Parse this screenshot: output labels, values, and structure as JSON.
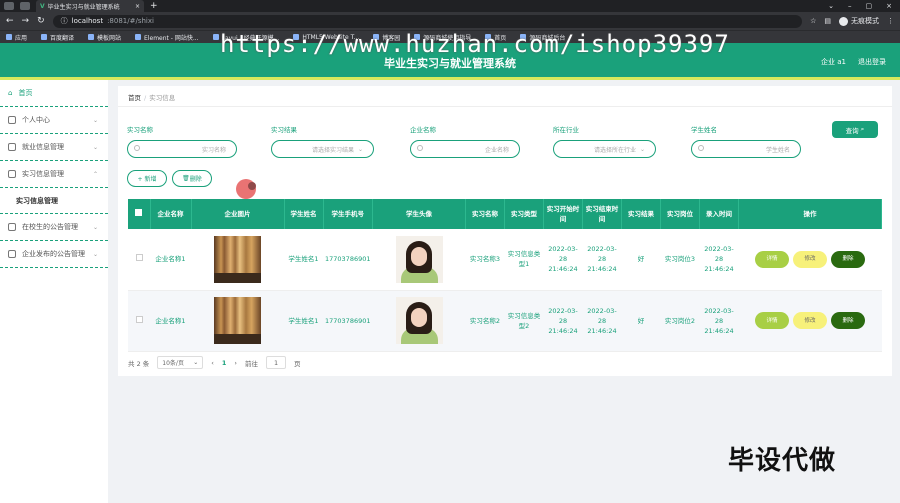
{
  "browser": {
    "tab_title": "毕业生实习与就业管理系统",
    "url_host": "localhost",
    "url_rest": ":8081/#/shixi",
    "incognito": "无痕模式",
    "bookmarks": [
      "应用",
      "百度翻译",
      "模板网站",
      "Element - 网站快...",
      "Layui - 经典开源模...",
      "HTML5 Website T...",
      "博客园",
      "源码商城使用指导",
      "首页",
      "源码商城后台"
    ]
  },
  "watermark": "https://www.huzhan.com/ishop39397",
  "header": {
    "title": "毕业生实习与就业管理系统",
    "user": "企业 a1",
    "logout": "退出登录"
  },
  "sidebar": {
    "home": "首页",
    "items": [
      "个人中心",
      "就业信息管理",
      "实习信息管理"
    ],
    "submenu": "实习信息管理",
    "items2": [
      "在校生的公告管理",
      "企业发布的公告管理"
    ]
  },
  "breadcrumb": {
    "home": "首页",
    "current": "实习信息"
  },
  "filters": [
    {
      "label": "实习名称",
      "placeholder": "实习名称"
    },
    {
      "label": "实习结果",
      "placeholder": "请选择实习结果"
    },
    {
      "label": "企业名称",
      "placeholder": "企业名称"
    },
    {
      "label": "所在行业",
      "placeholder": "请选择所在行业"
    },
    {
      "label": "学生姓名",
      "placeholder": "学生姓名"
    }
  ],
  "buttons": {
    "search": "查询",
    "add": "+ 新增",
    "delete": "删除"
  },
  "table": {
    "headers": [
      "企业名称",
      "企业图片",
      "学生姓名",
      "学生手机号",
      "学生头像",
      "实习名称",
      "实习类型",
      "实习开始时间",
      "实习结束时间",
      "实习结果",
      "实习岗位",
      "录入时间",
      "操作"
    ],
    "rows": [
      {
        "company": "企业名称1",
        "student": "学生姓名1",
        "phone": "17703786901",
        "intern_name": "实习名称3",
        "intern_type": "实习信息类型1",
        "start": "2022-03-28 21:46:24",
        "end": "2022-03-28 21:46:24",
        "result": "好",
        "position": "实习岗位3",
        "created": "2022-03-28 21:46:24"
      },
      {
        "company": "企业名称1",
        "student": "学生姓名1",
        "phone": "17703786901",
        "intern_name": "实习名称2",
        "intern_type": "实习信息类型2",
        "start": "2022-03-28 21:46:24",
        "end": "2022-03-28 21:46:24",
        "result": "好",
        "position": "实习岗位2",
        "created": "2022-03-28 21:46:24"
      }
    ],
    "ops": {
      "detail": "详情",
      "edit": "修改",
      "del": "删除"
    }
  },
  "pager": {
    "total": "共 2 条",
    "size": "10条/页",
    "current": "1",
    "goto": "前往",
    "page_input": "1",
    "page_unit": "页"
  },
  "corner_text": "毕设代做"
}
